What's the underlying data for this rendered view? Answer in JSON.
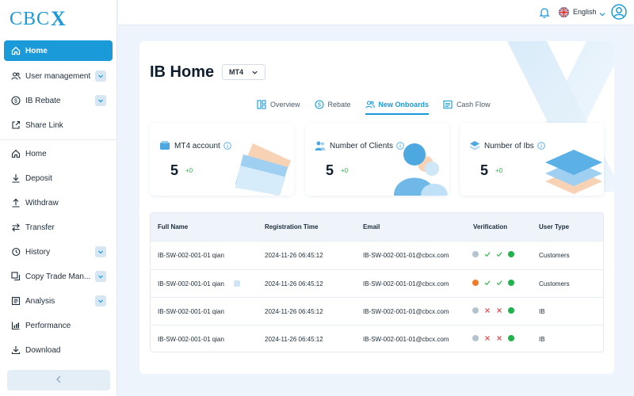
{
  "brand": {
    "logo_text": "CBC",
    "logo_accent": "X"
  },
  "sidebar": {
    "items": [
      {
        "label": "Home",
        "icon": "home-icon",
        "active": true
      },
      {
        "label": "User management",
        "icon": "users-icon",
        "expandable": true
      },
      {
        "label": "IB Rebate",
        "icon": "dollar-icon",
        "expandable": true
      },
      {
        "label": "Share Link",
        "icon": "share-link-icon"
      },
      {
        "label": "Home",
        "icon": "home-icon"
      },
      {
        "label": "Deposit",
        "icon": "deposit-icon"
      },
      {
        "label": "Withdraw",
        "icon": "withdraw-icon"
      },
      {
        "label": "Transfer",
        "icon": "transfer-icon"
      },
      {
        "label": "History",
        "icon": "history-icon",
        "expandable": true
      },
      {
        "label": "Copy Trade Man...",
        "icon": "copy-trade-icon",
        "expandable": true
      },
      {
        "label": "Analysis",
        "icon": "analysis-icon",
        "expandable": true
      },
      {
        "label": "Performance",
        "icon": "performance-icon"
      },
      {
        "label": "Download",
        "icon": "download-icon"
      }
    ],
    "collapse_icon": "chevron-left-icon"
  },
  "topbar": {
    "language": "English"
  },
  "page": {
    "title": "IB Home",
    "platform": "MT4",
    "tabs": [
      {
        "label": "Overview",
        "icon": "overview-icon"
      },
      {
        "label": "Rebate",
        "icon": "rebate-icon"
      },
      {
        "label": "New Onboards",
        "icon": "onboard-icon",
        "active": true
      },
      {
        "label": "Cash Flow",
        "icon": "cashflow-icon"
      }
    ]
  },
  "stats": [
    {
      "title": "MT4 account",
      "value": "5",
      "delta": "+0"
    },
    {
      "title": "Number of Clients",
      "value": "5",
      "delta": "+0"
    },
    {
      "title": "Number of Ibs",
      "value": "5",
      "delta": "+0"
    }
  ],
  "table": {
    "columns": [
      "Full Name",
      "Registration Time",
      "Email",
      "Verification",
      "User Type"
    ],
    "rows": [
      {
        "name": "IB-SW-002-001-01 qian",
        "time": "2024-11-26 06:45:12",
        "email": "IB-SW-002-001-01@cbcx.com",
        "verification": [
          "grey-dot",
          "check",
          "check",
          "green-dot"
        ],
        "type": "Customers",
        "badge": false
      },
      {
        "name": "IB-SW-002-001-01 qian",
        "time": "2024-11-26 06:45:12",
        "email": "IB-SW-002-001-01@cbcx.com",
        "verification": [
          "orange-dot",
          "check",
          "check",
          "green-dot"
        ],
        "type": "Customers",
        "badge": true
      },
      {
        "name": "IB-SW-002-001-01 qian",
        "time": "2024-11-26 06:45:12",
        "email": "IB-SW-002-001-01@cbcx.com",
        "verification": [
          "grey-dot",
          "cross",
          "cross",
          "green-dot"
        ],
        "type": "IB",
        "badge": false
      },
      {
        "name": "IB-SW-002-001-01 qian",
        "time": "2024-11-26 06:45:12",
        "email": "IB-SW-002-001-01@cbcx.com",
        "verification": [
          "grey-dot",
          "cross",
          "cross",
          "green-dot"
        ],
        "type": "IB",
        "badge": false
      }
    ]
  },
  "colors": {
    "accent": "#1a9ad9",
    "success": "#2eb24a",
    "danger": "#e5484d",
    "warning": "#f07c2a",
    "muted": "#b6c2cd",
    "green_dot": "#20b24b"
  }
}
